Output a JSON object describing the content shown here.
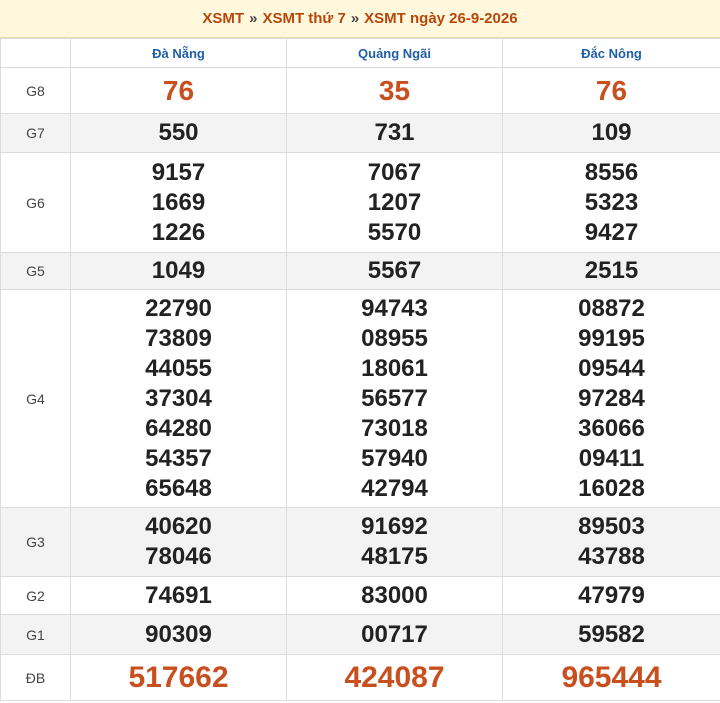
{
  "breadcrumb": {
    "items": [
      "XSMT",
      "XSMT thứ 7",
      "XSMT ngày 26-9-2026"
    ],
    "separator": "»"
  },
  "provinces": [
    "Đà Nẵng",
    "Quảng Ngãi",
    "Đắc Nông"
  ],
  "prizes": [
    {
      "label": "G8",
      "values": [
        [
          "76"
        ],
        [
          "35"
        ],
        [
          "76"
        ]
      ]
    },
    {
      "label": "G7",
      "values": [
        [
          "550"
        ],
        [
          "731"
        ],
        [
          "109"
        ]
      ]
    },
    {
      "label": "G6",
      "values": [
        [
          "9157",
          "1669",
          "1226"
        ],
        [
          "7067",
          "1207",
          "5570"
        ],
        [
          "8556",
          "5323",
          "9427"
        ]
      ]
    },
    {
      "label": "G5",
      "values": [
        [
          "1049"
        ],
        [
          "5567"
        ],
        [
          "2515"
        ]
      ]
    },
    {
      "label": "G4",
      "values": [
        [
          "22790",
          "73809",
          "44055",
          "37304",
          "64280",
          "54357",
          "65648"
        ],
        [
          "94743",
          "08955",
          "18061",
          "56577",
          "73018",
          "57940",
          "42794"
        ],
        [
          "08872",
          "99195",
          "09544",
          "97284",
          "36066",
          "09411",
          "16028"
        ]
      ]
    },
    {
      "label": "G3",
      "values": [
        [
          "40620",
          "78046"
        ],
        [
          "91692",
          "48175"
        ],
        [
          "89503",
          "43788"
        ]
      ]
    },
    {
      "label": "G2",
      "values": [
        [
          "74691"
        ],
        [
          "83000"
        ],
        [
          "47979"
        ]
      ]
    },
    {
      "label": "G1",
      "values": [
        [
          "90309"
        ],
        [
          "00717"
        ],
        [
          "59582"
        ]
      ]
    },
    {
      "label": "ĐB",
      "values": [
        [
          "517662"
        ],
        [
          "424087"
        ],
        [
          "965444"
        ]
      ]
    }
  ],
  "colors": {
    "accent_orange": "#c8501e",
    "header_blue": "#1f5fa6",
    "breadcrumb_bg": "#fff8dc"
  }
}
